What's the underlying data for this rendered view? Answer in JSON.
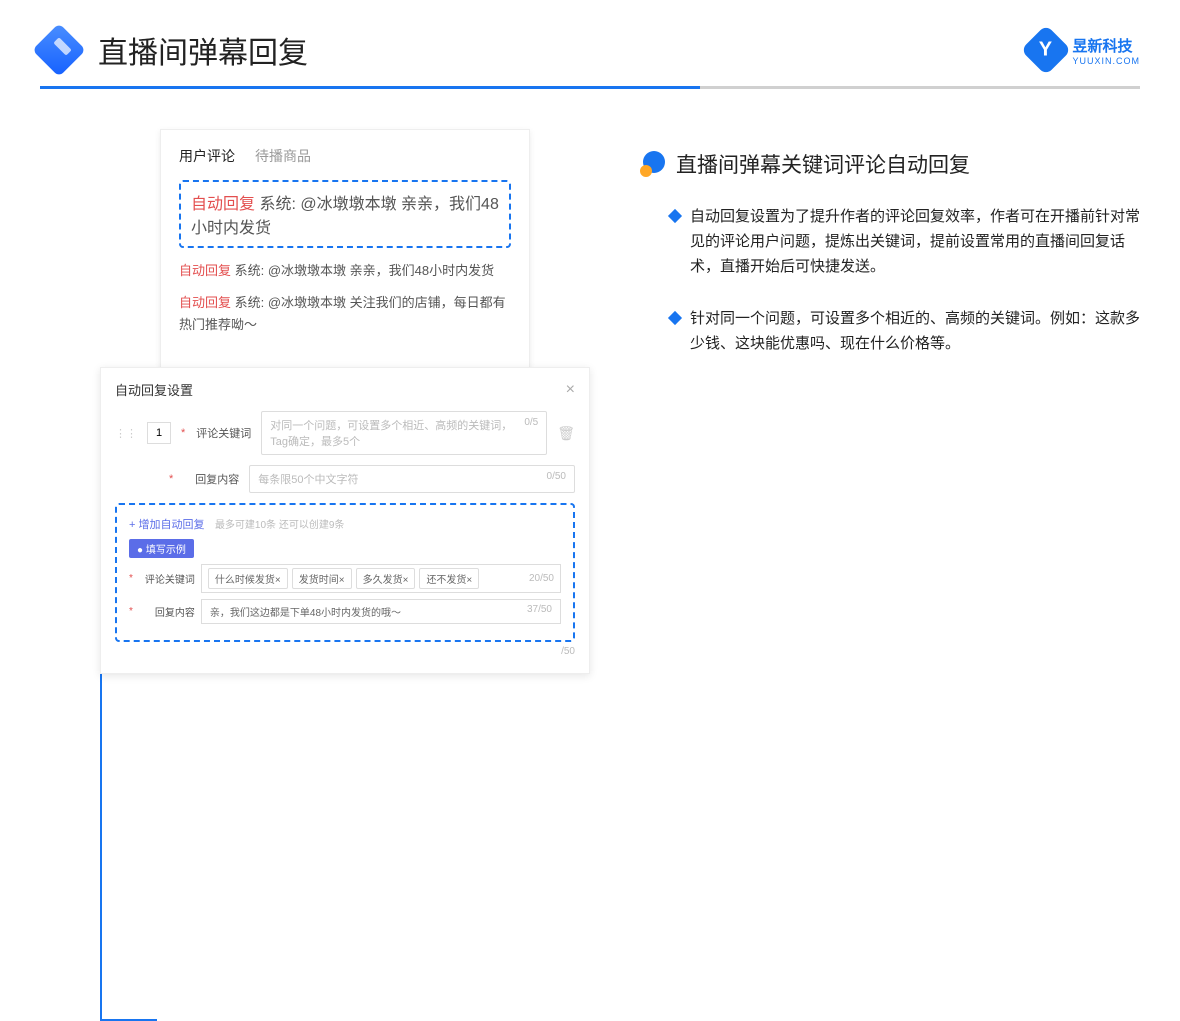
{
  "header": {
    "title": "直播间弹幕回复"
  },
  "brand": {
    "name": "昱新科技",
    "sub": "YUUXIN.COM",
    "icon_letter": "Y"
  },
  "comments_box": {
    "tab_active": "用户评论",
    "tab_inactive": "待播商品",
    "highlighted": {
      "badge": "自动回复",
      "text": "系统: @冰墩墩本墩 亲亲，我们48小时内发货"
    },
    "rows": [
      {
        "badge": "自动回复",
        "text": "系统: @冰墩墩本墩 亲亲，我们48小时内发货"
      },
      {
        "badge": "自动回复",
        "text": "系统: @冰墩墩本墩 关注我们的店铺，每日都有热门推荐呦～"
      }
    ]
  },
  "settings": {
    "title": "自动回复设置",
    "num": "1",
    "keyword_label": "评论关键词",
    "keyword_placeholder": "对同一个问题，可设置多个相近、高频的关键词，Tag确定，最多5个",
    "keyword_counter": "0/5",
    "content_label": "回复内容",
    "content_placeholder": "每条限50个中文字符",
    "content_counter": "0/50",
    "add_link": "+ 增加自动回复",
    "add_hint": "最多可建10条 还可以创建9条",
    "example_badge": "● 填写示例",
    "ex_keyword_label": "评论关键词",
    "ex_tags": [
      "什么时候发货×",
      "发货时间×",
      "多久发货×",
      "还不发货×"
    ],
    "ex_tag_counter": "20/50",
    "ex_content_label": "回复内容",
    "ex_content": "亲，我们这边都是下单48小时内发货的哦～",
    "ex_content_counter": "37/50",
    "outer_counter": "/50"
  },
  "right": {
    "section_title": "直播间弹幕关键词评论自动回复",
    "bullets": [
      "自动回复设置为了提升作者的评论回复效率，作者可在开播前针对常见的评论用户问题，提炼出关键词，提前设置常用的直播间回复话术，直播开始后可快捷发送。",
      "针对同一个问题，可设置多个相近的、高频的关键词。例如：这款多少钱、这块能优惠吗、现在什么价格等。"
    ]
  }
}
